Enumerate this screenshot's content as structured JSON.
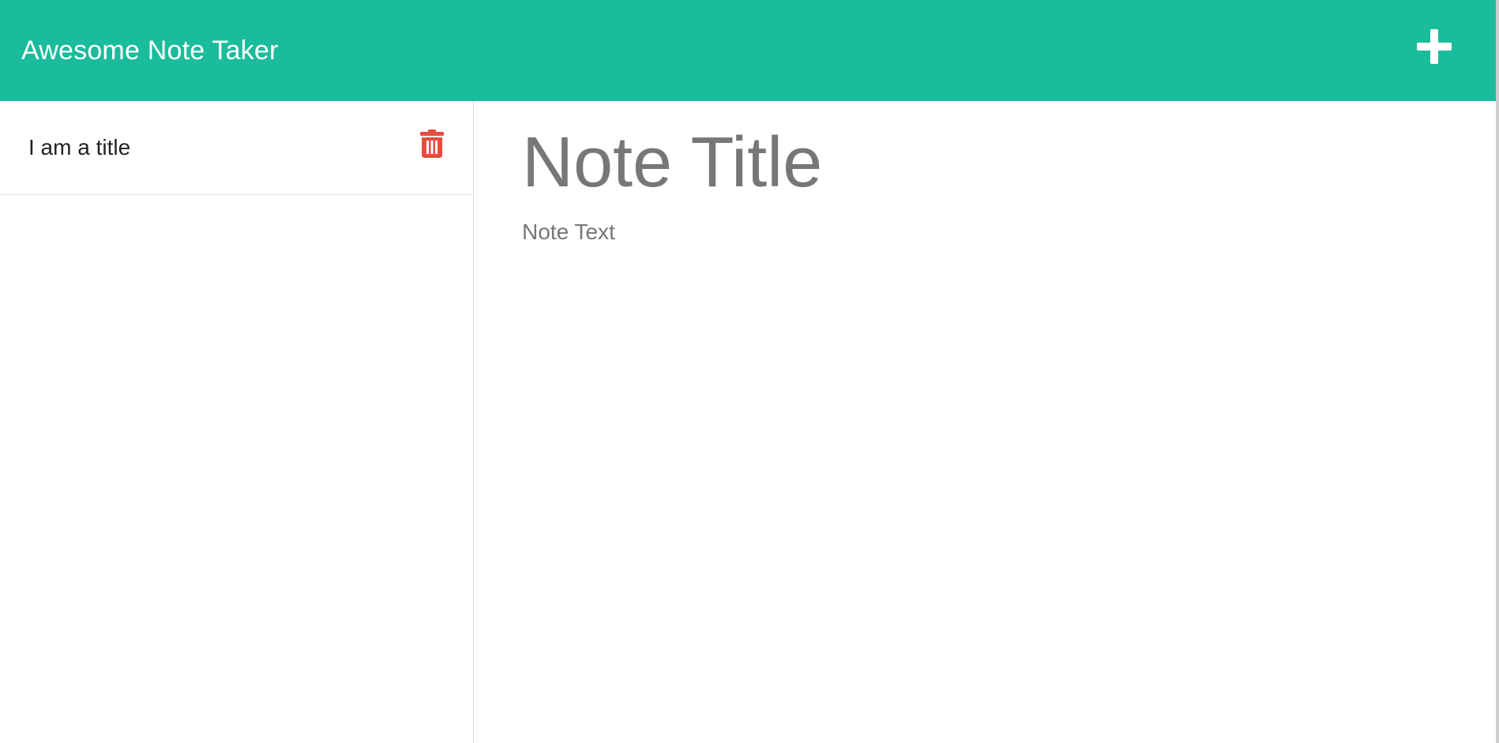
{
  "navbar": {
    "brand": "Awesome Note Taker",
    "new_note_icon": "plus-icon",
    "color": "#1abc9c"
  },
  "sidebar": {
    "notes": [
      {
        "title": "I am a title",
        "delete_icon": "trash-icon",
        "delete_color": "#e74c3c"
      }
    ]
  },
  "editor": {
    "title_placeholder": "Note Title",
    "text_placeholder": "Note Text"
  }
}
